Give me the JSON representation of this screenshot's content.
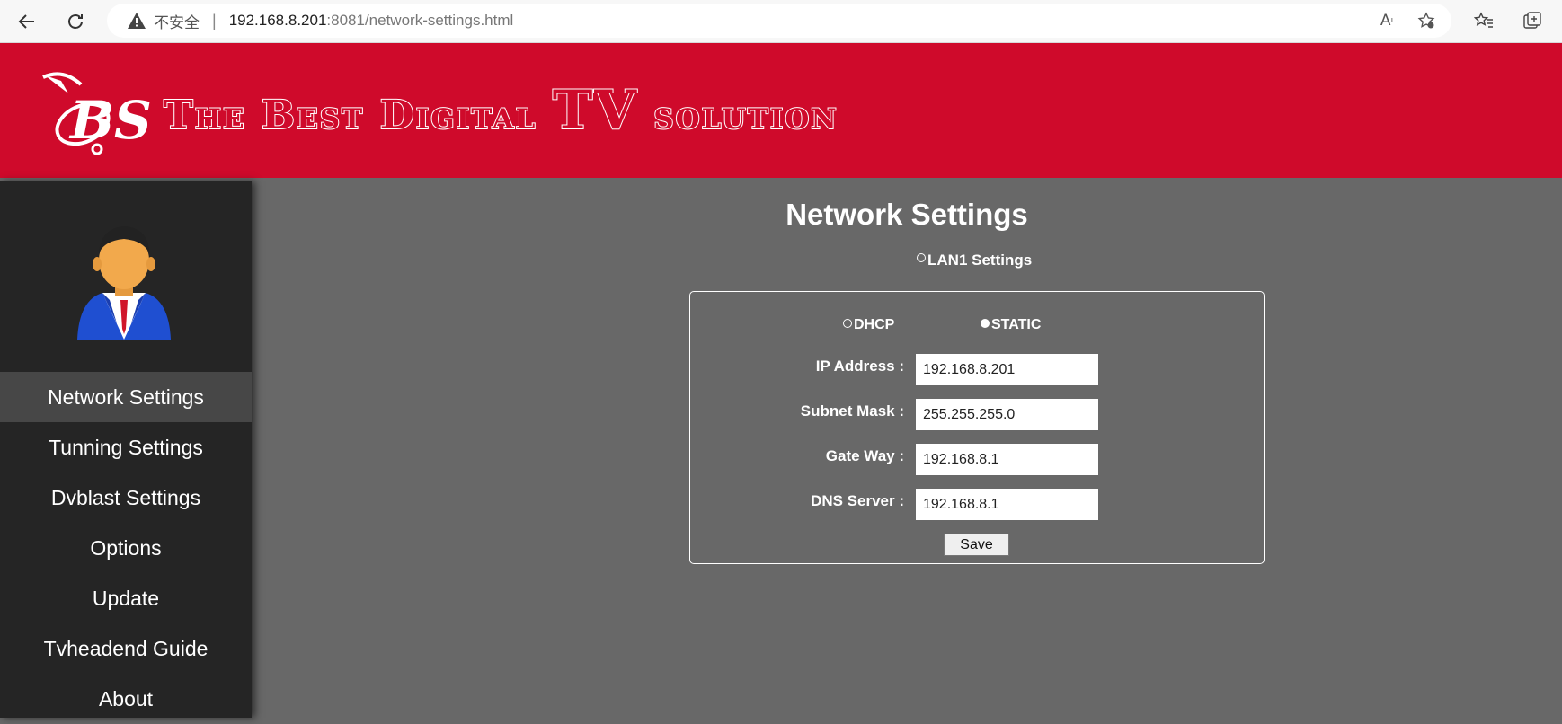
{
  "browser": {
    "insecure_label": "不安全",
    "url_host": "192.168.8.201",
    "url_rest": ":8081/network-settings.html"
  },
  "banner": {
    "title_part1": "The Best Digital ",
    "title_part2": "TV",
    "title_part3": " solution",
    "logo_text": "BS",
    "color": "#cf0a2b"
  },
  "sidebar": {
    "items": [
      {
        "label": "Network Settings",
        "active": true
      },
      {
        "label": "Tunning Settings"
      },
      {
        "label": "Dvblast Settings"
      },
      {
        "label": "Options"
      },
      {
        "label": "Update"
      },
      {
        "label": "Tvheadend Guide"
      },
      {
        "label": "About"
      }
    ]
  },
  "main": {
    "title": "Network Settings",
    "lan_option": "LAN1 Settings",
    "mode": {
      "dhcp_label": "DHCP",
      "static_label": "STATIC",
      "selected": "STATIC"
    },
    "fields": {
      "ip_label": "IP Address :",
      "ip_value": "192.168.8.201",
      "subnet_label": "Subnet Mask :",
      "subnet_value": "255.255.255.0",
      "gateway_label": "Gate Way :",
      "gateway_value": "192.168.8.1",
      "dns_label": "DNS Server :",
      "dns_value": "192.168.8.1"
    },
    "save_label": "Save"
  }
}
